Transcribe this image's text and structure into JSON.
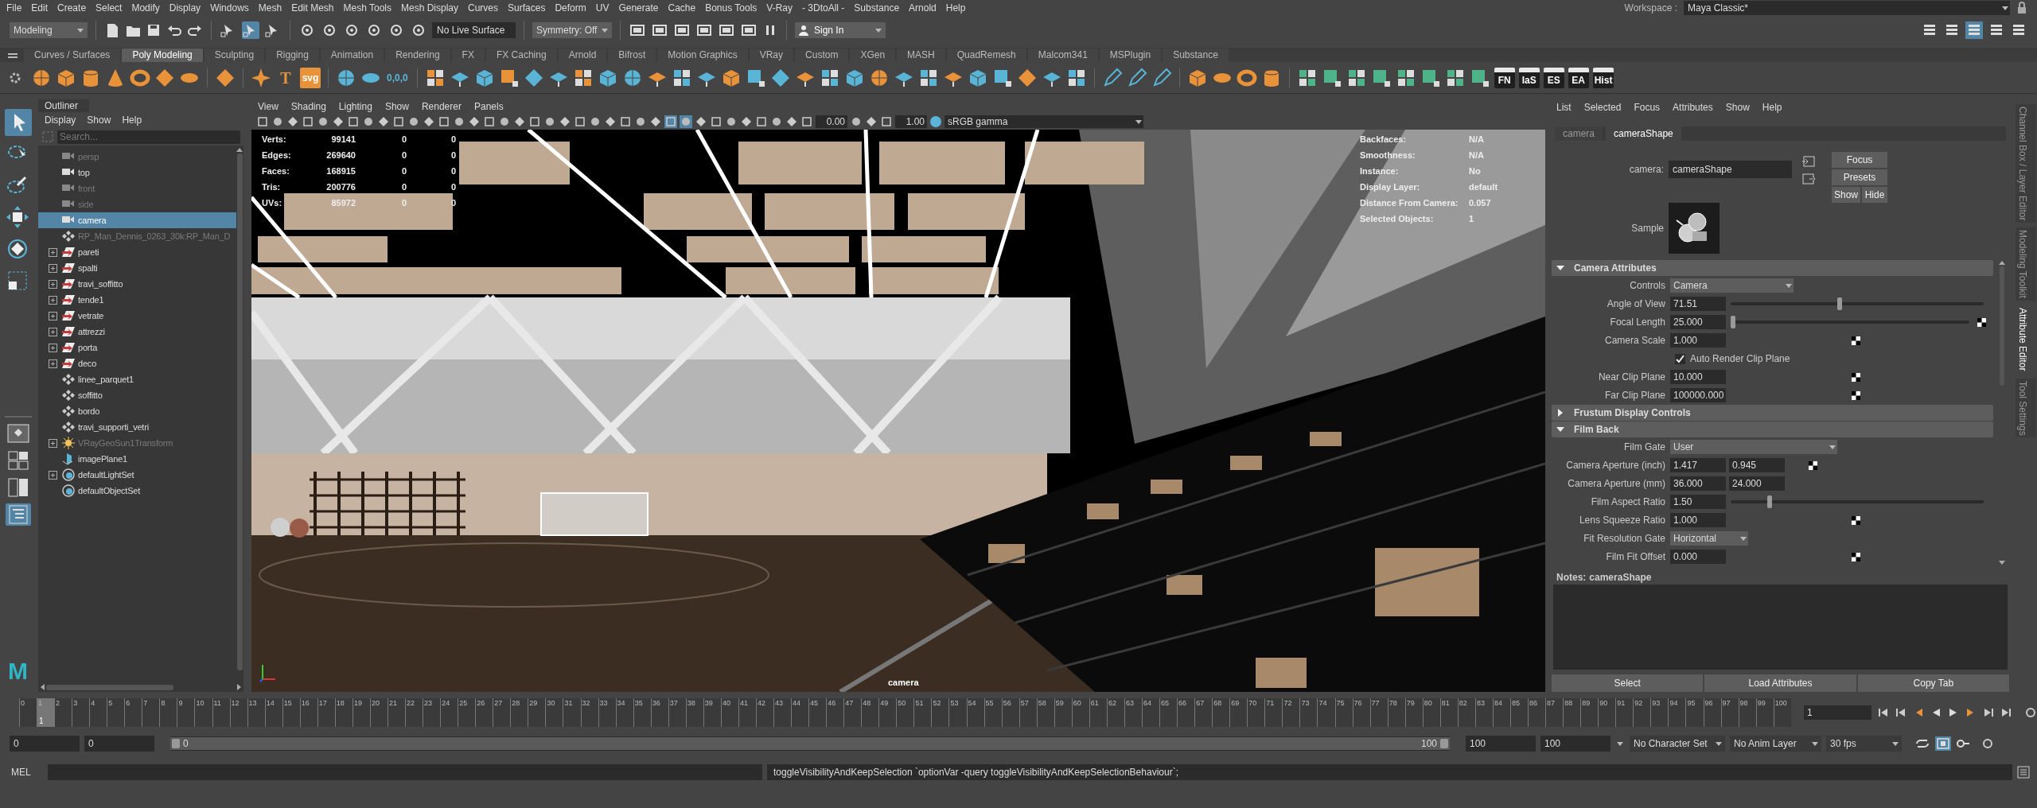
{
  "menu_bar": [
    "File",
    "Edit",
    "Create",
    "Select",
    "Modify",
    "Display",
    "Windows",
    "Mesh",
    "Edit Mesh",
    "Mesh Tools",
    "Mesh Display",
    "Curves",
    "Surfaces",
    "Deform",
    "UV",
    "Generate",
    "Cache",
    "Bonus Tools",
    "V-Ray",
    "- 3DtoAll -",
    "Substance",
    "Arnold",
    "Help"
  ],
  "workspace": {
    "label": "Workspace :",
    "value": "Maya Classic*"
  },
  "status_line": {
    "mode": "Modeling",
    "select_modes": [
      {
        "selected": false
      },
      {
        "selected": true
      },
      {
        "selected": false
      }
    ],
    "live_surface": "No Live Surface",
    "symmetry": "Symmetry: Off",
    "sign_in": "Sign In",
    "panel_toggles": [
      {
        "selected": false
      },
      {
        "selected": false
      },
      {
        "selected": true
      },
      {
        "selected": false
      },
      {
        "selected": false
      }
    ]
  },
  "shelf": {
    "tabs": [
      {
        "label": "Curves / Surfaces",
        "selected": false
      },
      {
        "label": "Poly Modeling",
        "selected": true
      },
      {
        "label": "Sculpting",
        "selected": false
      },
      {
        "label": "Rigging",
        "selected": false
      },
      {
        "label": "Animation",
        "selected": false
      },
      {
        "label": "Rendering",
        "selected": false
      },
      {
        "label": "FX",
        "selected": false
      },
      {
        "label": "FX Caching",
        "selected": false
      },
      {
        "label": "Arnold",
        "selected": false
      },
      {
        "label": "Bifrost",
        "selected": false
      },
      {
        "label": "Motion Graphics",
        "selected": false
      },
      {
        "label": "VRay",
        "selected": false
      },
      {
        "label": "Custom",
        "selected": false
      },
      {
        "label": "XGen",
        "selected": false
      },
      {
        "label": "MASH",
        "selected": false
      },
      {
        "label": "QuadRemesh",
        "selected": false
      },
      {
        "label": "Malcom341",
        "selected": false
      },
      {
        "label": "MSPlugin",
        "selected": false
      },
      {
        "label": "Substance",
        "selected": false
      }
    ],
    "icon_labels": [
      "T",
      "svg",
      "0,0,0",
      "FN",
      "IaS",
      "ES",
      "EA",
      "Hist"
    ]
  },
  "toolbox": {
    "tools": [
      {
        "selected": true
      },
      {
        "selected": false
      },
      {
        "selected": false
      },
      {
        "selected": false
      },
      {
        "selected": false
      },
      {
        "selected": false
      }
    ],
    "layouts": [
      {
        "selected": false
      },
      {
        "selected": false
      },
      {
        "selected": false
      },
      {
        "selected": true
      }
    ],
    "logo": "M"
  },
  "outliner": {
    "title": "Outliner",
    "menus": [
      "Display",
      "Show",
      "Help"
    ],
    "search": {
      "placeholder": "Search..."
    },
    "items": [
      {
        "label": "persp",
        "kind": "camera",
        "dimmed": true,
        "expandable": false,
        "selected": false
      },
      {
        "label": "top",
        "kind": "camera",
        "dimmed": false,
        "expandable": false,
        "selected": false
      },
      {
        "label": "front",
        "kind": "camera",
        "dimmed": true,
        "expandable": false,
        "selected": false
      },
      {
        "label": "side",
        "kind": "camera",
        "dimmed": true,
        "expandable": false,
        "selected": false
      },
      {
        "label": "camera",
        "kind": "camera",
        "dimmed": false,
        "expandable": false,
        "selected": true
      },
      {
        "label": "RP_Man_Dennis_0263_30k:RP_Man_D",
        "kind": "mesh",
        "dimmed": true,
        "expandable": false,
        "selected": false
      },
      {
        "label": "pareti",
        "kind": "group",
        "dimmed": false,
        "expandable": true,
        "selected": false
      },
      {
        "label": "spalti",
        "kind": "group",
        "dimmed": false,
        "expandable": true,
        "selected": false
      },
      {
        "label": "travi_soffitto",
        "kind": "group",
        "dimmed": false,
        "expandable": true,
        "selected": false
      },
      {
        "label": "tende1",
        "kind": "group",
        "dimmed": false,
        "expandable": true,
        "selected": false
      },
      {
        "label": "vetrate",
        "kind": "group",
        "dimmed": false,
        "expandable": true,
        "selected": false
      },
      {
        "label": "attrezzi",
        "kind": "group",
        "dimmed": false,
        "expandable": true,
        "selected": false
      },
      {
        "label": "porta",
        "kind": "group",
        "dimmed": false,
        "expandable": true,
        "selected": false
      },
      {
        "label": "deco",
        "kind": "group",
        "dimmed": false,
        "expandable": true,
        "selected": false
      },
      {
        "label": "linee_parquet1",
        "kind": "mesh",
        "dimmed": false,
        "expandable": false,
        "selected": false
      },
      {
        "label": "soffitto",
        "kind": "mesh",
        "dimmed": false,
        "expandable": false,
        "selected": false
      },
      {
        "label": "bordo",
        "kind": "mesh",
        "dimmed": false,
        "expandable": false,
        "selected": false
      },
      {
        "label": "travi_supporti_vetri",
        "kind": "mesh",
        "dimmed": false,
        "expandable": false,
        "selected": false
      },
      {
        "label": "VRayGeoSun1Transform",
        "kind": "light",
        "dimmed": true,
        "expandable": true,
        "selected": false
      },
      {
        "label": "imagePlane1",
        "kind": "image_plane",
        "dimmed": false,
        "expandable": false,
        "selected": false
      },
      {
        "label": "defaultLightSet",
        "kind": "set",
        "dimmed": false,
        "expandable": true,
        "selected": false
      },
      {
        "label": "defaultObjectSet",
        "kind": "set",
        "dimmed": false,
        "expandable": false,
        "selected": false
      }
    ]
  },
  "viewport": {
    "menus": [
      "View",
      "Shading",
      "Lighting",
      "Show",
      "Renderer",
      "Panels"
    ],
    "exposure": "0.00",
    "gamma": "1.00",
    "color_space": "sRGB gamma",
    "stats": [
      {
        "label": "Verts:",
        "value": "99141",
        "col_2": "0",
        "col_3": "0"
      },
      {
        "label": "Edges:",
        "value": "269640",
        "col_2": "0",
        "col_3": "0"
      },
      {
        "label": "Faces:",
        "value": "168915",
        "col_2": "0",
        "col_3": "0"
      },
      {
        "label": "Tris:",
        "value": "200776",
        "col_2": "0",
        "col_3": "0"
      },
      {
        "label": "UVs:",
        "value": "85972",
        "col_2": "0",
        "col_3": "0"
      }
    ],
    "info": [
      {
        "label": "Backfaces:",
        "value": "N/A"
      },
      {
        "label": "Smoothness:",
        "value": "N/A"
      },
      {
        "label": "Instance:",
        "value": "No"
      },
      {
        "label": "Display Layer:",
        "value": "default"
      },
      {
        "label": "Distance From Camera:",
        "value": "0.057"
      },
      {
        "label": "Selected Objects:",
        "value": "1"
      }
    ],
    "camera_name": "camera"
  },
  "attribute_editor": {
    "menus": [
      "List",
      "Selected",
      "Focus",
      "Attributes",
      "Show",
      "Help"
    ],
    "tabs": [
      {
        "label": "camera",
        "selected": false
      },
      {
        "label": "cameraShape",
        "selected": true
      }
    ],
    "node_label": "camera:",
    "node_name": "cameraShape",
    "buttons": [
      "Focus",
      "Presets",
      "Show",
      "Hide"
    ],
    "sample_label": "Sample",
    "sections": [
      {
        "title": "Camera Attributes",
        "expanded": true,
        "rows": [
          {
            "kind": "dropdown",
            "label": "Controls",
            "value": "Camera"
          },
          {
            "kind": "slider",
            "label": "Angle of View",
            "value": "71.51",
            "level": 0.43
          },
          {
            "kind": "slider_map",
            "label": "Focal Length",
            "value": "25.000",
            "level": 0.01
          },
          {
            "kind": "field_map",
            "label": "Camera Scale",
            "value": "1.000"
          },
          {
            "kind": "checkbox",
            "label": "Auto Render Clip Plane",
            "checked": true
          },
          {
            "kind": "field_map",
            "label": "Near Clip Plane",
            "value": "10.000"
          },
          {
            "kind": "field_map",
            "label": "Far Clip Plane",
            "value": "100000.000"
          }
        ]
      },
      {
        "title": "Frustum Display Controls",
        "expanded": false
      },
      {
        "title": "Film Back",
        "expanded": true,
        "rows": [
          {
            "kind": "dropdown_wide",
            "label": "Film Gate",
            "value": "User"
          },
          {
            "kind": "pair_map",
            "label": "Camera Aperture (inch)",
            "value": "1.417",
            "value_2": "0.945"
          },
          {
            "kind": "pair",
            "label": "Camera Aperture (mm)",
            "value": "36.000",
            "value_2": "24.000"
          },
          {
            "kind": "slider",
            "label": "Film Aspect Ratio",
            "value": "1.50",
            "level": 0.155
          },
          {
            "kind": "field_map",
            "label": "Lens Squeeze Ratio",
            "value": "1.000"
          },
          {
            "kind": "dropdown",
            "label": "Fit Resolution Gate",
            "value": "Horizontal"
          },
          {
            "kind": "field_map",
            "label": "Film Fit Offset",
            "value": "0.000"
          }
        ]
      }
    ],
    "notes_label": "Notes:",
    "notes_node": "cameraShape",
    "bottom_buttons": [
      "Select",
      "Load Attributes",
      "Copy Tab"
    ]
  },
  "side_tabs": [
    {
      "label": "Channel Box / Layer Editor",
      "selected": false
    },
    {
      "label": "Modeling Toolkit",
      "selected": false
    },
    {
      "label": "Attribute Editor",
      "selected": true
    },
    {
      "label": "Tool Settings",
      "selected": false
    }
  ],
  "timeline": {
    "frames": [
      {
        "label": "0",
        "selected": false
      },
      {
        "label": "1",
        "selected": true
      },
      {
        "label": "2",
        "selected": false
      },
      {
        "label": "3",
        "selected": false
      },
      {
        "label": "4",
        "selected": false
      },
      {
        "label": "5",
        "selected": false
      },
      {
        "label": "6",
        "selected": false
      },
      {
        "label": "7",
        "selected": false
      },
      {
        "label": "8",
        "selected": false
      },
      {
        "label": "9",
        "selected": false
      },
      {
        "label": "10",
        "selected": false
      },
      {
        "label": "11",
        "selected": false
      },
      {
        "label": "12",
        "selected": false
      },
      {
        "label": "13",
        "selected": false
      },
      {
        "label": "14",
        "selected": false
      },
      {
        "label": "15",
        "selected": false
      },
      {
        "label": "16",
        "selected": false
      },
      {
        "label": "17",
        "selected": false
      },
      {
        "label": "18",
        "selected": false
      },
      {
        "label": "19",
        "selected": false
      },
      {
        "label": "20",
        "selected": false
      },
      {
        "label": "21",
        "selected": false
      },
      {
        "label": "22",
        "selected": false
      },
      {
        "label": "23",
        "selected": false
      },
      {
        "label": "24",
        "selected": false
      },
      {
        "label": "25",
        "selected": false
      },
      {
        "label": "26",
        "selected": false
      },
      {
        "label": "27",
        "selected": false
      },
      {
        "label": "28",
        "selected": false
      },
      {
        "label": "29",
        "selected": false
      },
      {
        "label": "30",
        "selected": false
      },
      {
        "label": "31",
        "selected": false
      },
      {
        "label": "32",
        "selected": false
      },
      {
        "label": "33",
        "selected": false
      },
      {
        "label": "34",
        "selected": false
      },
      {
        "label": "35",
        "selected": false
      },
      {
        "label": "36",
        "selected": false
      },
      {
        "label": "37",
        "selected": false
      },
      {
        "label": "38",
        "selected": false
      },
      {
        "label": "39",
        "selected": false
      },
      {
        "label": "40",
        "selected": false
      },
      {
        "label": "41",
        "selected": false
      },
      {
        "label": "42",
        "selected": false
      },
      {
        "label": "43",
        "selected": false
      },
      {
        "label": "44",
        "selected": false
      },
      {
        "label": "45",
        "selected": false
      },
      {
        "label": "46",
        "selected": false
      },
      {
        "label": "47",
        "selected": false
      },
      {
        "label": "48",
        "selected": false
      },
      {
        "label": "49",
        "selected": false
      },
      {
        "label": "50",
        "selected": false
      },
      {
        "label": "51",
        "selected": false
      },
      {
        "label": "52",
        "selected": false
      },
      {
        "label": "53",
        "selected": false
      },
      {
        "label": "54",
        "selected": false
      },
      {
        "label": "55",
        "selected": false
      },
      {
        "label": "56",
        "selected": false
      },
      {
        "label": "57",
        "selected": false
      },
      {
        "label": "58",
        "selected": false
      },
      {
        "label": "59",
        "selected": false
      },
      {
        "label": "60",
        "selected": false
      },
      {
        "label": "61",
        "selected": false
      },
      {
        "label": "62",
        "selected": false
      },
      {
        "label": "63",
        "selected": false
      },
      {
        "label": "64",
        "selected": false
      },
      {
        "label": "65",
        "selected": false
      },
      {
        "label": "66",
        "selected": false
      },
      {
        "label": "67",
        "selected": false
      },
      {
        "label": "68",
        "selected": false
      },
      {
        "label": "69",
        "selected": false
      },
      {
        "label": "70",
        "selected": false
      },
      {
        "label": "71",
        "selected": false
      },
      {
        "label": "72",
        "selected": false
      },
      {
        "label": "73",
        "selected": false
      },
      {
        "label": "74",
        "selected": false
      },
      {
        "label": "75",
        "selected": false
      },
      {
        "label": "76",
        "selected": false
      },
      {
        "label": "77",
        "selected": false
      },
      {
        "label": "78",
        "selected": false
      },
      {
        "label": "79",
        "selected": false
      },
      {
        "label": "80",
        "selected": false
      },
      {
        "label": "81",
        "selected": false
      },
      {
        "label": "82",
        "selected": false
      },
      {
        "label": "83",
        "selected": false
      },
      {
        "label": "84",
        "selected": false
      },
      {
        "label": "85",
        "selected": false
      },
      {
        "label": "86",
        "selected": false
      },
      {
        "label": "87",
        "selected": false
      },
      {
        "label": "88",
        "selected": false
      },
      {
        "label": "89",
        "selected": false
      },
      {
        "label": "90",
        "selected": false
      },
      {
        "label": "91",
        "selected": false
      },
      {
        "label": "92",
        "selected": false
      },
      {
        "label": "93",
        "selected": false
      },
      {
        "label": "94",
        "selected": false
      },
      {
        "label": "95",
        "selected": false
      },
      {
        "label": "96",
        "selected": false
      },
      {
        "label": "97",
        "selected": false
      },
      {
        "label": "98",
        "selected": false
      },
      {
        "label": "99",
        "selected": false
      },
      {
        "label": "100",
        "selected": false
      }
    ],
    "cursor_label": "1",
    "current_frame": "1",
    "auto_key": true
  },
  "range": {
    "start": "0",
    "inner_start": "0",
    "slider_start": "0",
    "slider_end": "100",
    "inner_end": "100",
    "end": "100",
    "character_set": "No Character Set",
    "anim_layer": "No Anim Layer",
    "fps": "30 fps",
    "level": 1
  },
  "command_line": {
    "language": "MEL",
    "result": "toggleVisibilityAndKeepSelection `optionVar -query toggleVisibilityAndKeepSelectionBehaviour`;"
  }
}
